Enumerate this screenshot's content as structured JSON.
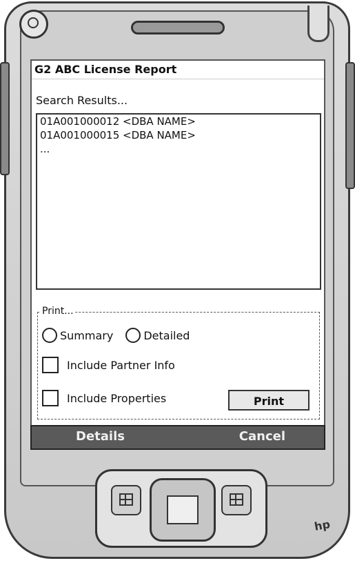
{
  "window": {
    "title": "G2 ABC License Report"
  },
  "search": {
    "label": "Search Results..."
  },
  "results": [
    "01A001000012 <DBA NAME>",
    "01A001000015 <DBA NAME>",
    "..."
  ],
  "print_group": {
    "legend": "Print...",
    "radio_summary": "Summary",
    "radio_detailed": "Detailed",
    "check_partner": "Include Partner Info",
    "check_properties": "Include Properties",
    "print_button": "Print"
  },
  "softkeys": {
    "left": "Details",
    "right": "Cancel"
  },
  "device": {
    "logo": "hp"
  }
}
